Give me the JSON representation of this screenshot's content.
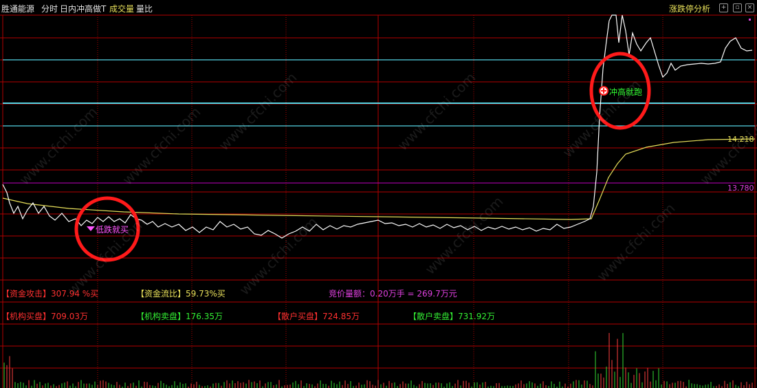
{
  "header": {
    "stock_name": "胜通能源",
    "view_mode": "分时",
    "indicator_name": "日内冲高做T",
    "volume_tab": "成交量",
    "ratio_tab": "量比",
    "analysis_button": "涨跌停分析"
  },
  "price_labels": {
    "avg_price": "14.218",
    "ref_price": "13.780"
  },
  "signals": {
    "buy_signal": "低跌就买",
    "sell_signal": "冲高就跑"
  },
  "indicators": {
    "attack_label": "【资金攻击】",
    "attack_value": "307.94 %买",
    "flow_label": "【资金流比】",
    "flow_value": "59.73%买",
    "auction_text": "竞价量额：0.20万手 = 269.7万元",
    "inst_buy_label": "【机构买盘】",
    "inst_buy_value": "709.03万",
    "inst_sell_label": "【机构卖盘】",
    "inst_sell_value": "176.35万",
    "retail_buy_label": "【散户买盘】",
    "retail_buy_value": "724.85万",
    "retail_sell_label": "【散户卖盘】",
    "retail_sell_value": "731.92万"
  },
  "watermark": "www.cfchi.com",
  "colors": {
    "grid": "#b40000",
    "cyan_line": "#55d6e6",
    "price_line": "#ffffff",
    "avg_line": "#e8e05a",
    "magenta_line": "#c000c0",
    "signal_circle": "#ff1a1a",
    "buy_signal": "#ff55ff",
    "sell_signal": "#33ff33",
    "up_bar": "#ff4040",
    "down_bar": "#33dd33"
  }
}
